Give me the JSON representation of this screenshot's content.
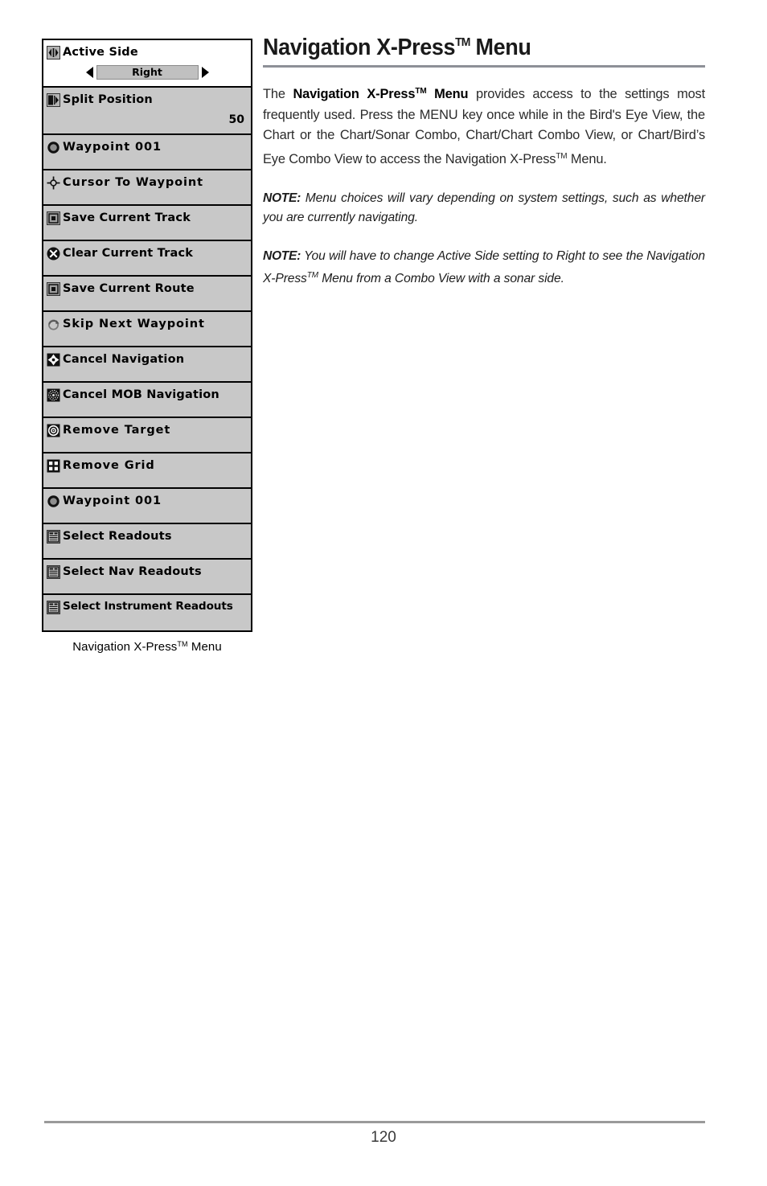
{
  "document": {
    "page_number": "120"
  },
  "figure": {
    "caption": "Navigation X-Press™ Menu",
    "menu": {
      "rows": [
        {
          "icon": "left-right-arrows-icon",
          "label": "Active Side",
          "selected": true,
          "control": "selector",
          "value": "Right"
        },
        {
          "icon": "split-position-icon",
          "label": "Split Position",
          "selected": false,
          "control": "numeric",
          "value": "50"
        },
        {
          "icon": "waypoint-circle-icon",
          "label": "Waypoint 001",
          "selected": false,
          "control": "none",
          "value": ""
        },
        {
          "icon": "cursor-crosshair-icon",
          "label": "Cursor To Waypoint",
          "selected": false,
          "control": "none",
          "value": ""
        },
        {
          "icon": "save-track-icon",
          "label": "Save Current Track",
          "selected": false,
          "control": "none",
          "value": ""
        },
        {
          "icon": "clear-track-x-icon",
          "label": "Clear Current Track",
          "selected": false,
          "control": "none",
          "value": ""
        },
        {
          "icon": "save-route-icon",
          "label": "Save Current Route",
          "selected": false,
          "control": "none",
          "value": ""
        },
        {
          "icon": "skip-waypoint-arrow-icon",
          "label": "Skip Next Waypoint",
          "selected": false,
          "control": "none",
          "value": ""
        },
        {
          "icon": "cancel-navigation-icon",
          "label": "Cancel Navigation",
          "selected": false,
          "control": "none",
          "value": ""
        },
        {
          "icon": "cancel-mob-navigation-icon",
          "label": "Cancel MOB Navigation",
          "selected": false,
          "control": "none",
          "value": ""
        },
        {
          "icon": "remove-target-icon",
          "label": "Remove Target",
          "selected": false,
          "control": "none",
          "value": ""
        },
        {
          "icon": "remove-grid-icon",
          "label": "Remove Grid",
          "selected": false,
          "control": "none",
          "value": ""
        },
        {
          "icon": "waypoint-circle-icon",
          "label": "Waypoint 001",
          "selected": false,
          "control": "none",
          "value": ""
        },
        {
          "icon": "select-readouts-icon",
          "label": "Select Readouts",
          "selected": false,
          "control": "none",
          "value": ""
        },
        {
          "icon": "select-readouts-icon",
          "label": "Select Nav Readouts",
          "selected": false,
          "control": "none",
          "value": ""
        },
        {
          "icon": "select-readouts-icon",
          "label": "Select Instrument Readouts",
          "selected": false,
          "control": "none",
          "value": ""
        }
      ]
    }
  },
  "content": {
    "heading": "Navigation X-Press™ Menu",
    "paragraph_1": {
      "before_bold": "The ",
      "bold": "Navigation X-Press™ Menu",
      "after_bold": " provides access to the settings most frequently used. Press the MENU key once while in the Bird's Eye View, the Chart or the Chart/Sonar Combo, Chart/Chart Combo View, or Chart/Bird’s Eye Combo View to access the Navigation X-Press™ Menu."
    },
    "note_1": {
      "lead": "NOTE:",
      "text": " Menu choices will vary depending on system settings, such as whether you are currently navigating."
    },
    "note_2": {
      "lead": "NOTE:",
      "text": " You will have to change Active Side setting to Right to see the Navigation X-Press™ Menu from a Combo View with a sonar side."
    }
  },
  "colors": {
    "menu_background": "#c8c8c8",
    "menu_selected_background": "#ffffff",
    "menu_border": "#000000",
    "rule": "#8d9097",
    "footer_rule": "#9a9a9a"
  }
}
